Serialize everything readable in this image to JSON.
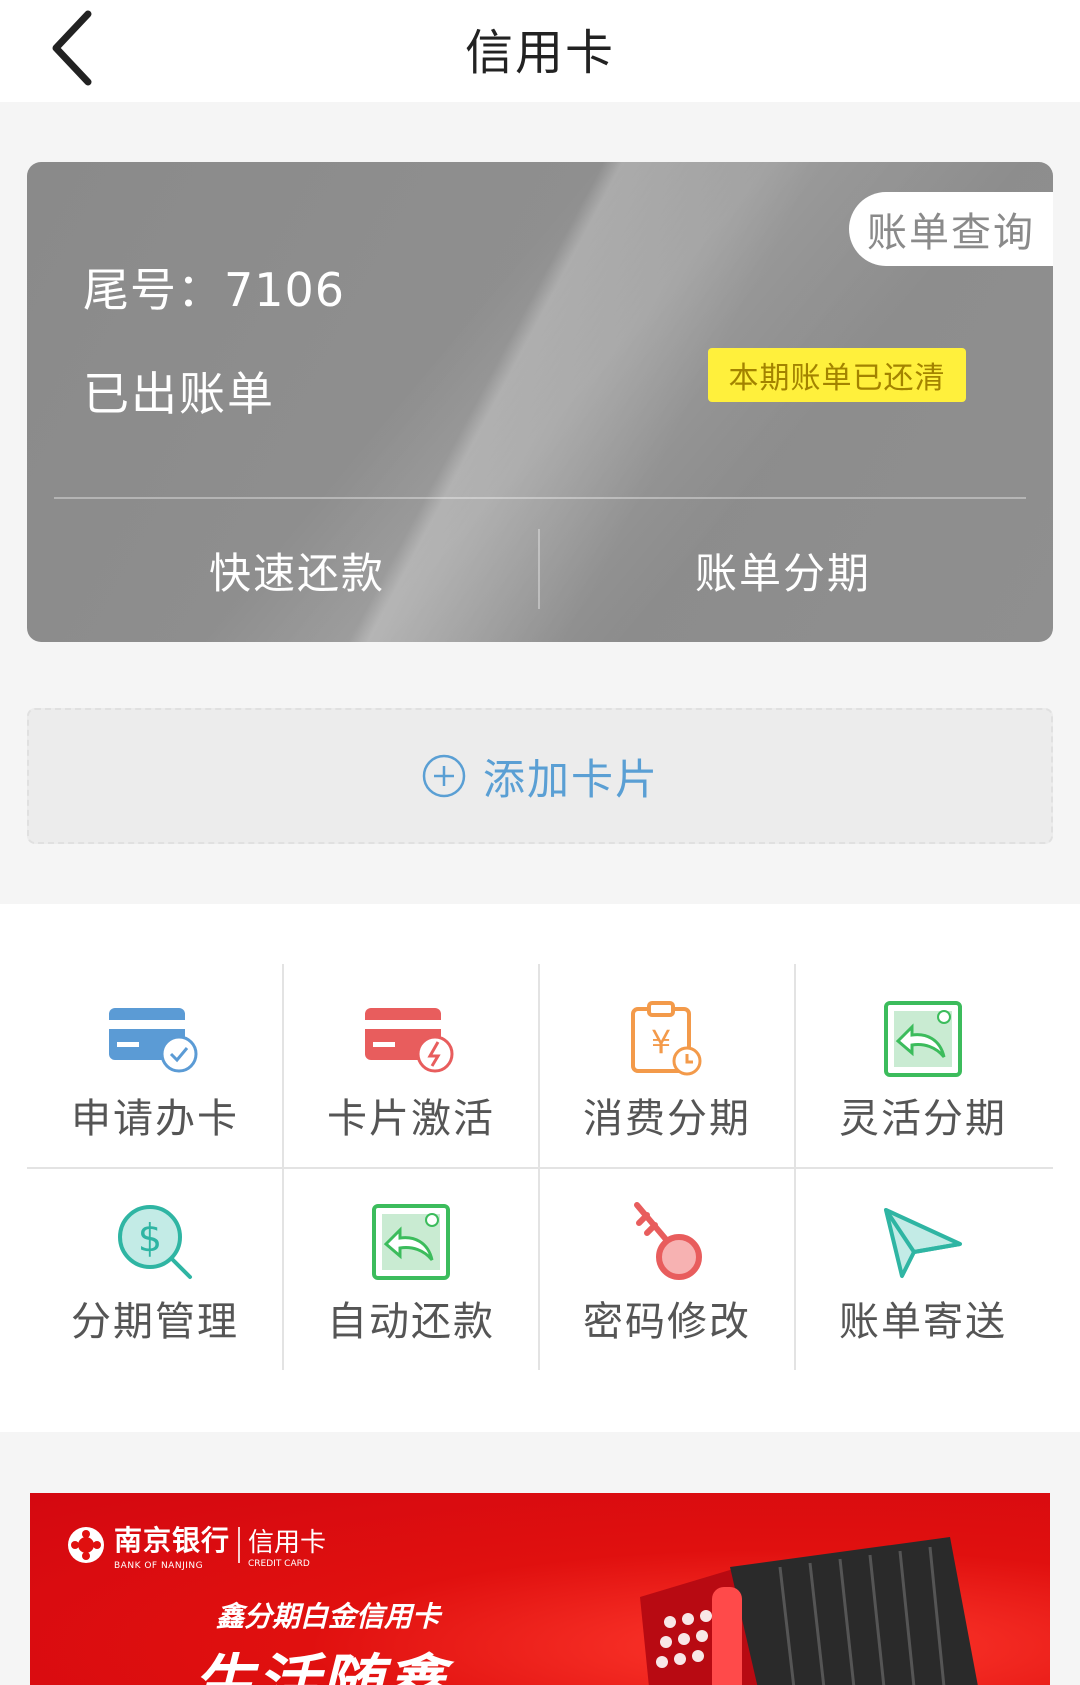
{
  "header": {
    "title": "信用卡",
    "back_icon": "chevron-left-icon"
  },
  "card": {
    "bill_query_label": "账单查询",
    "tail_label": "尾号：7106",
    "status_label": "已出账单",
    "badge_label": "本期账单已还清",
    "actions": {
      "quick_repay": "快速还款",
      "bill_installment": "账单分期"
    },
    "badge_color": "#fff03c"
  },
  "add_card": {
    "label": "添加卡片",
    "icon": "plus-circle-icon"
  },
  "services": [
    {
      "label": "申请办卡",
      "icon": "card-check-icon"
    },
    {
      "label": "卡片激活",
      "icon": "card-bolt-icon"
    },
    {
      "label": "消费分期",
      "icon": "yuan-clipboard-icon"
    },
    {
      "label": "灵活分期",
      "icon": "return-arrow-icon"
    },
    {
      "label": "分期管理",
      "icon": "dollar-search-icon"
    },
    {
      "label": "自动还款",
      "icon": "return-arrow-icon"
    },
    {
      "label": "密码修改",
      "icon": "key-icon"
    },
    {
      "label": "账单寄送",
      "icon": "paper-plane-icon"
    }
  ],
  "banner": {
    "bank_name": "南京银行",
    "bank_name_en": "BANK OF NANJING",
    "card_label": "信用卡",
    "card_label_en": "CREDIT CARD",
    "subtitle": "鑫分期白金信用卡",
    "title": "生活随鑫",
    "bg_color": "#e0100f"
  }
}
